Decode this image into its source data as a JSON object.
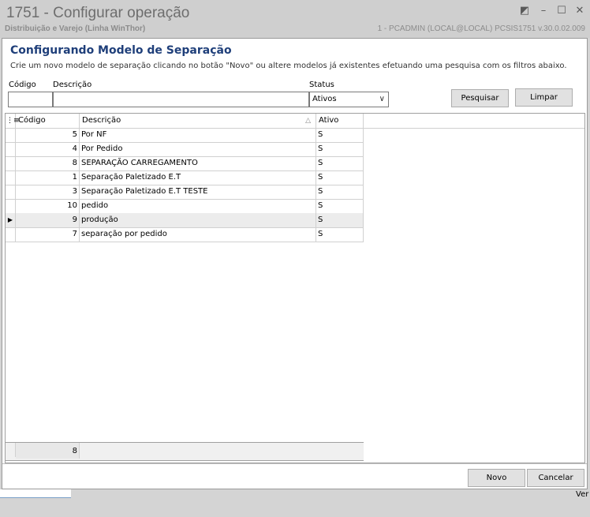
{
  "window": {
    "title": "1751 - Configurar operação",
    "subtitle": "Distribuição e Varejo (Linha WinThor)",
    "session": "1 - PCADMIN (LOCAL@LOCAL)   PCSIS1751  v.30.0.02.009"
  },
  "header": {
    "title": "Configurando Modelo de Separação",
    "description": "Crie um novo modelo de separação clicando no botão \"Novo\" ou altere modelos já existentes efetuando uma pesquisa com os filtros abaixo."
  },
  "filters": {
    "codigo_label": "Código",
    "codigo_value": "",
    "descricao_label": "Descrição",
    "descricao_value": "",
    "status_label": "Status",
    "status_value": "Ativos"
  },
  "buttons": {
    "pesquisar": "Pesquisar",
    "limpar": "Limpar",
    "novo": "Novo",
    "cancelar": "Cancelar"
  },
  "grid": {
    "columns": [
      "Código",
      "Descrição",
      "Ativo"
    ],
    "rows": [
      {
        "codigo": "5",
        "descricao": "Por NF",
        "ativo": "S"
      },
      {
        "codigo": "4",
        "descricao": "Por Pedido",
        "ativo": "S"
      },
      {
        "codigo": "8",
        "descricao": "SEPARAÇÃO CARREGAMENTO",
        "ativo": "S"
      },
      {
        "codigo": "1",
        "descricao": "Separação Paletizado E.T",
        "ativo": "S"
      },
      {
        "codigo": "3",
        "descricao": "Separação Paletizado E.T TESTE",
        "ativo": "S"
      },
      {
        "codigo": "10",
        "descricao": "pedido",
        "ativo": "S"
      },
      {
        "codigo": "9",
        "descricao": "produção",
        "ativo": "S"
      },
      {
        "codigo": "7",
        "descricao": "separação por pedido",
        "ativo": "S"
      }
    ],
    "selected_row": 6,
    "footer_count": "8"
  },
  "taskbar": {
    "right_text": "Ver"
  },
  "colors": {
    "header_title": "#1f3f7a",
    "selected_row_bg": "#ececec"
  }
}
